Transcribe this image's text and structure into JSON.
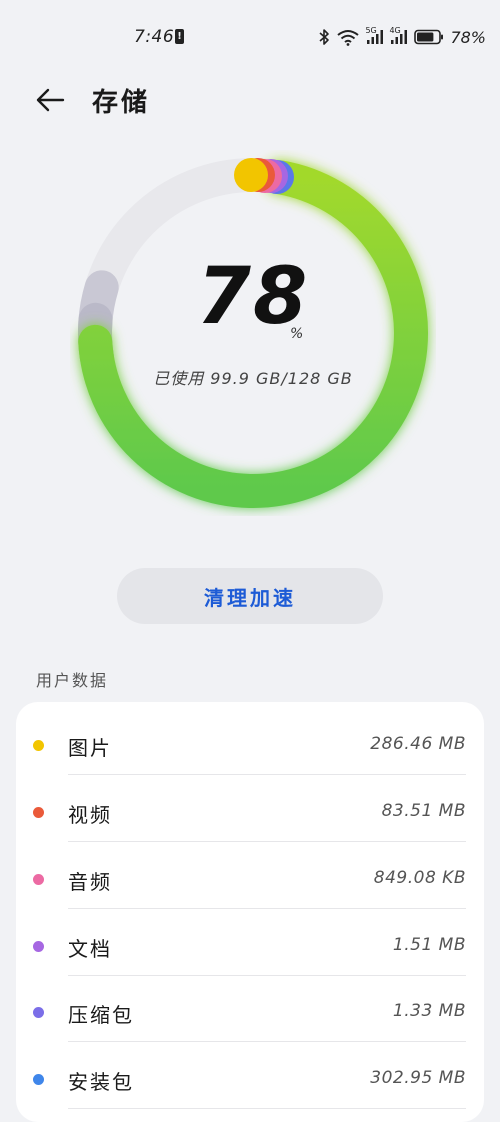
{
  "status": {
    "time": "7:46",
    "alert_glyph": "!",
    "net_5g": "5G",
    "net_4g": "4G",
    "battery_pct": "78%",
    "battery_level": 0.78,
    "icons": [
      "bluetooth-icon",
      "wifi-icon",
      "signal-icon",
      "battery-icon"
    ]
  },
  "header": {
    "title": "存储",
    "back_icon": "arrow-left-icon"
  },
  "usage": {
    "percent_value": "78",
    "percent_unit": "%",
    "detail": "已使用 99.9 GB/128 GB",
    "fraction": 0.78
  },
  "actions": {
    "clean_label": "清理加速"
  },
  "user_data": {
    "title": "用户数据",
    "items": [
      {
        "label": "图片",
        "size": "286.46 MB",
        "color": "#f2c500"
      },
      {
        "label": "视频",
        "size": "83.51 MB",
        "color": "#ea5a3a"
      },
      {
        "label": "音频",
        "size": "849.08 KB",
        "color": "#ec6aa3"
      },
      {
        "label": "文档",
        "size": "1.51 MB",
        "color": "#a667e2"
      },
      {
        "label": "压缩包",
        "size": "1.33 MB",
        "color": "#7b6ee8"
      },
      {
        "label": "安装包",
        "size": "302.95 MB",
        "color": "#3f86ea"
      }
    ]
  },
  "colors": {
    "accent": "#1d5bd6",
    "ring_green_start": "#9ed832",
    "ring_green_end": "#5cc94a",
    "ring_track": "#e8e8ec",
    "ring_system": "#c9c8d4"
  }
}
